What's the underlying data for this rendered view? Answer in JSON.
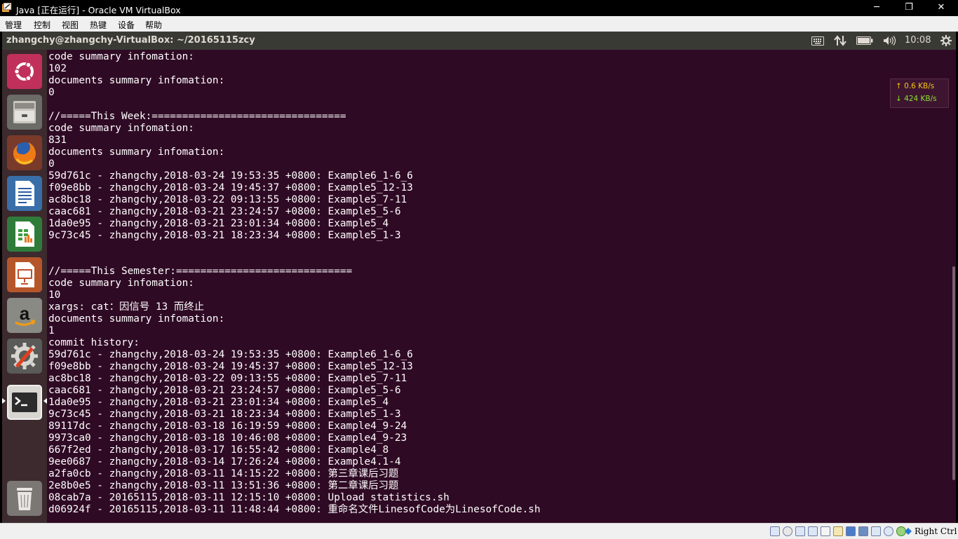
{
  "window": {
    "title": "Java [正在运行] - Oracle VM VirtualBox",
    "minimize": "─",
    "restore": "❐",
    "close": "✕"
  },
  "vb_menu": [
    "管理",
    "控制",
    "视图",
    "热键",
    "设备",
    "帮助"
  ],
  "ubuntu_panel": {
    "title": "zhangchy@zhangchy-VirtualBox: ~/20165115zcy",
    "clock": "10:08",
    "indicators": [
      "keyboard-icon",
      "network-transfer-icon",
      "battery-icon",
      "volume-icon",
      "gear-icon"
    ]
  },
  "launcher": [
    "ubuntu-dash",
    "files",
    "firefox",
    "libreoffice-writer",
    "libreoffice-calc",
    "libreoffice-impress",
    "amazon",
    "system-settings",
    "terminal",
    "trash"
  ],
  "network": {
    "up": "↑ 0.6 KB/s",
    "down": "↓ 424 KB/s"
  },
  "terminal_lines": [
    "code summary infomation:",
    "102",
    "documents summary infomation:",
    "0",
    "",
    "//=====This Week:================================",
    "code summary infomation:",
    "831",
    "documents summary infomation:",
    "0",
    "59d761c - zhangchy,2018-03-24 19:53:35 +0800: Example6_1-6_6",
    "f09e8bb - zhangchy,2018-03-24 19:45:37 +0800: Example5_12-13",
    "ac8bc18 - zhangchy,2018-03-22 09:13:55 +0800: Example5_7-11",
    "caac681 - zhangchy,2018-03-21 23:24:57 +0800: Example5_5-6",
    "1da0e95 - zhangchy,2018-03-21 23:01:34 +0800: Example5_4",
    "9c73c45 - zhangchy,2018-03-21 18:23:34 +0800: Example5_1-3",
    "",
    "",
    "//=====This Semester:=============================",
    "code summary infomation:",
    "10",
    "xargs: cat：因信号 13 而终止",
    "documents summary infomation:",
    "1",
    "commit history:",
    "59d761c - zhangchy,2018-03-24 19:53:35 +0800: Example6_1-6_6",
    "f09e8bb - zhangchy,2018-03-24 19:45:37 +0800: Example5_12-13",
    "ac8bc18 - zhangchy,2018-03-22 09:13:55 +0800: Example5_7-11",
    "caac681 - zhangchy,2018-03-21 23:24:57 +0800: Example5_5-6",
    "1da0e95 - zhangchy,2018-03-21 23:01:34 +0800: Example5_4",
    "9c73c45 - zhangchy,2018-03-21 18:23:34 +0800: Example5_1-3",
    "89117dc - zhangchy,2018-03-18 16:19:59 +0800: Example4_9-24",
    "9973ca0 - zhangchy,2018-03-18 10:46:08 +0800: Example4_9-23",
    "667f2ed - zhangchy,2018-03-17 16:55:42 +0800: Example4_8",
    "9ee0687 - zhangchy,2018-03-14 17:26:24 +0800: Example4.1-4",
    "a2fa0cb - zhangchy,2018-03-11 14:15:22 +0800: 第三章课后习题",
    "2e8b0e5 - zhangchy,2018-03-11 13:51:36 +0800: 第二章课后习题",
    "08cab7a - 20165115,2018-03-11 12:15:10 +0800: Upload statistics.sh",
    "d06924f - 20165115,2018-03-11 11:48:44 +0800: 重命名文件LinesofCode为LinesofCode.sh"
  ],
  "status_bar": {
    "host_key": "Right Ctrl"
  }
}
